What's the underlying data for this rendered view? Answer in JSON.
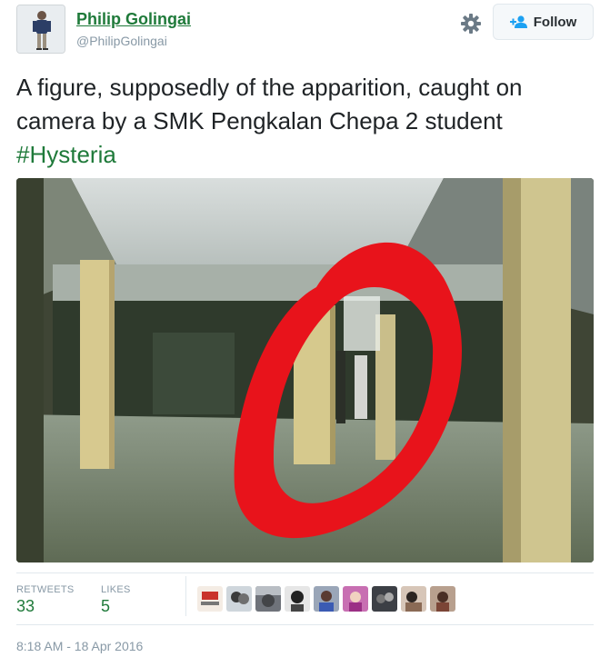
{
  "user": {
    "display_name": "Philip Golingai",
    "handle": "@PhilipGolingai",
    "avatar_icon": "person-standing-photo"
  },
  "actions": {
    "gear_icon": "gear-icon",
    "follow_icon": "add-user-icon",
    "follow_label": "Follow"
  },
  "tweet": {
    "text": "A figure, supposedly of the apparition, caught on camera by a SMK Pengkalan Chepa 2 student",
    "hashtag": "#Hysteria"
  },
  "media": {
    "description_icon": "photo-corridor-with-red-circle"
  },
  "stats": {
    "retweets_label": "RETWEETS",
    "retweets_value": "33",
    "likes_label": "LIKES",
    "likes_value": "5"
  },
  "timestamp": "8:18 AM - 18 Apr 2016",
  "colors": {
    "link_green": "#1f7a3a",
    "muted_gray": "#8899a6",
    "highlight_red": "#e8131b"
  }
}
